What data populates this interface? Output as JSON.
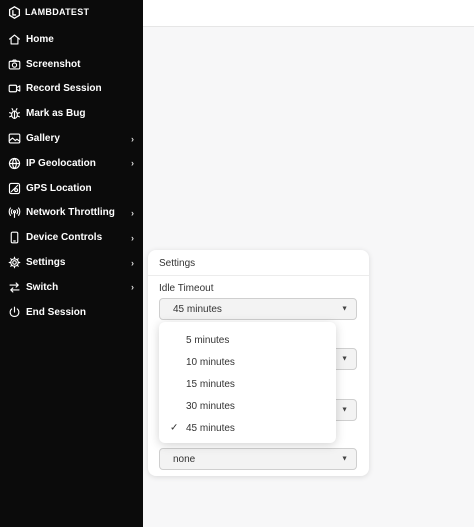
{
  "brand": {
    "name": "LAMBDATEST"
  },
  "sidebar": {
    "items": [
      {
        "label": "Home",
        "icon": "home-icon",
        "has_submenu": false
      },
      {
        "label": "Screenshot",
        "icon": "camera-icon",
        "has_submenu": false
      },
      {
        "label": "Record Session",
        "icon": "video-icon",
        "has_submenu": false
      },
      {
        "label": "Mark as Bug",
        "icon": "bug-icon",
        "has_submenu": false
      },
      {
        "label": "Gallery",
        "icon": "gallery-icon",
        "has_submenu": true
      },
      {
        "label": "IP Geolocation",
        "icon": "globe-icon",
        "has_submenu": true
      },
      {
        "label": "GPS Location",
        "icon": "map-icon",
        "has_submenu": false
      },
      {
        "label": "Network Throttling",
        "icon": "signal-icon",
        "has_submenu": true
      },
      {
        "label": "Device Controls",
        "icon": "device-icon",
        "has_submenu": true
      },
      {
        "label": "Settings",
        "icon": "gear-icon",
        "has_submenu": true
      },
      {
        "label": "Switch",
        "icon": "switch-icon",
        "has_submenu": true
      },
      {
        "label": "End Session",
        "icon": "power-icon",
        "has_submenu": false
      }
    ]
  },
  "settings_panel": {
    "title": "Settings",
    "idle_timeout": {
      "label": "Idle Timeout",
      "value": "45 minutes"
    },
    "last_field": {
      "value": "none"
    }
  },
  "dropdown": {
    "options": [
      "5 minutes",
      "10 minutes",
      "15 minutes",
      "30 minutes",
      "45 minutes"
    ],
    "selected": "45 minutes"
  },
  "colors": {
    "sidebar_bg": "#0b0b0b",
    "page_bg": "#f7f7f8"
  }
}
